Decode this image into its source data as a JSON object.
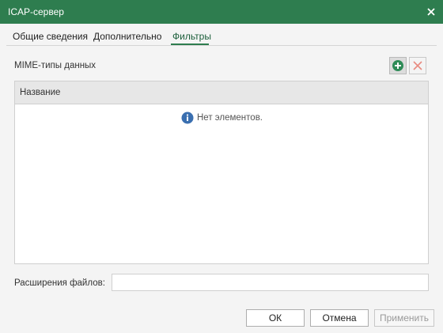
{
  "window": {
    "title": "ICAP-сервер"
  },
  "tabs": [
    {
      "label": "Общие сведения",
      "active": false
    },
    {
      "label": "Дополнительно",
      "active": false
    },
    {
      "label": "Фильтры",
      "active": true
    }
  ],
  "mime": {
    "label": "MIME-типы данных",
    "add_icon": "add-icon",
    "delete_icon": "delete-icon"
  },
  "grid": {
    "columns": [
      "Название"
    ],
    "rows": [],
    "empty_text": "Нет элементов.",
    "empty_icon": "info-icon"
  },
  "extensions": {
    "label": "Расширения файлов:",
    "value": ""
  },
  "buttons": {
    "ok": "ОК",
    "cancel": "Отмена",
    "apply": "Применить"
  },
  "colors": {
    "titlebar": "#2e7d4f",
    "add_icon": "#2e8b57",
    "delete_icon": "#e88a80",
    "info_icon": "#3a6fb0"
  }
}
